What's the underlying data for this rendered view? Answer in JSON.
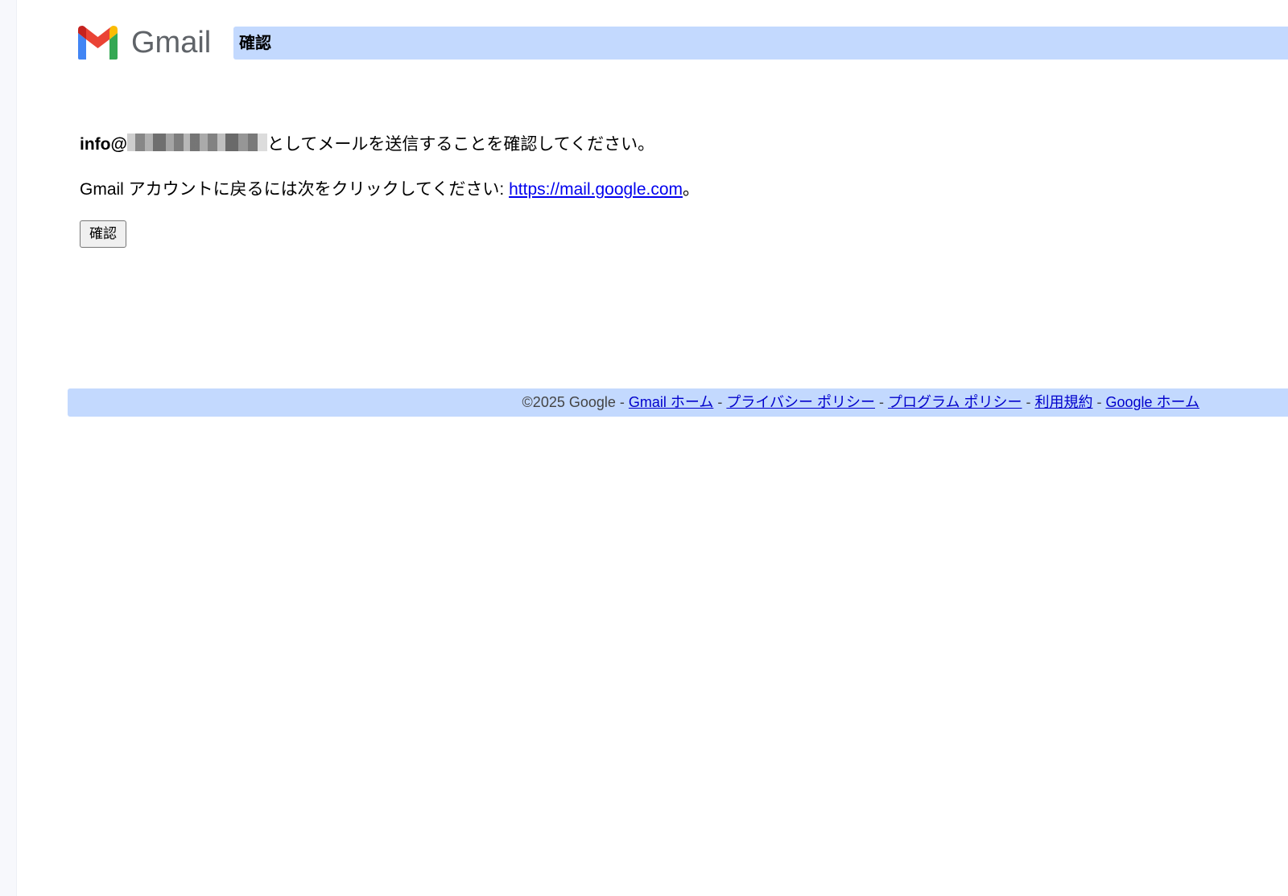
{
  "brand": {
    "logo_text": "Gmail",
    "logo_icon": "gmail-m-logo"
  },
  "header": {
    "title": "確認"
  },
  "main": {
    "email_local": "info@",
    "confirm_message": "としてメールを送信することを確認してください。",
    "return_text": "Gmail アカウントに戻るには次をクリックしてください: ",
    "return_link": "https://mail.google.com",
    "return_period": "。",
    "confirm_button_label": "確認"
  },
  "footer": {
    "copyright": "©2025 Google",
    "separator": " - ",
    "links": [
      "Gmail ホーム",
      "プライバシー ポリシー",
      "プログラム ポリシー",
      "利用規約",
      "Google ホーム"
    ]
  },
  "colors": {
    "title_bar_background": "#c3d9fe",
    "link": "#0000ee",
    "logo_text": "#5f6368"
  }
}
